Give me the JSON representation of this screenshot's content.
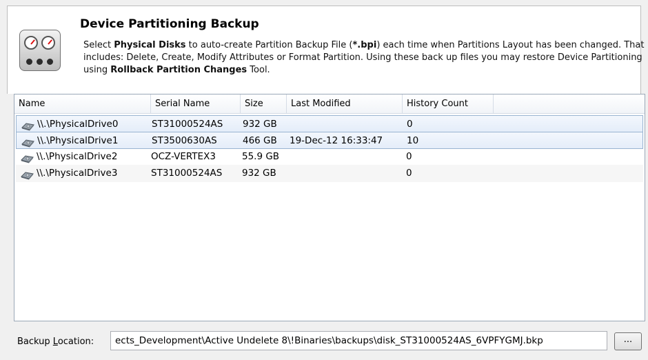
{
  "header": {
    "title": "Device Partitioning Backup",
    "desc": [
      {
        "t": "Select "
      },
      {
        "t": "Physical Disks",
        "b": true
      },
      {
        "t": " to auto-create  Partition Backup File ("
      },
      {
        "t": "*.bpi",
        "b": true
      },
      {
        "t": ") each time when Partitions Layout has been changed. That includes: Delete, Create, Modify Attributes or Format Partition. Using these back up files you may restore Device Partitioning using "
      },
      {
        "t": "Rollback Partition Changes",
        "b": true
      },
      {
        "t": " Tool."
      }
    ]
  },
  "columns": [
    "Name",
    "Serial Name",
    "Size",
    "Last Modified",
    "History Count"
  ],
  "rows": [
    {
      "name": "\\\\.\\PhysicalDrive0",
      "serial": "ST31000524AS",
      "size": "932 GB",
      "modified": "",
      "history": "0",
      "state": "selected"
    },
    {
      "name": "\\\\.\\PhysicalDrive1",
      "serial": "ST3500630AS",
      "size": "466 GB",
      "modified": "19-Dec-12 16:33:47",
      "history": "10",
      "state": "selected"
    },
    {
      "name": "\\\\.\\PhysicalDrive2",
      "serial": "OCZ-VERTEX3",
      "size": "55.9 GB",
      "modified": "",
      "history": "0",
      "state": "normal"
    },
    {
      "name": "\\\\.\\PhysicalDrive3",
      "serial": "ST31000524AS",
      "size": "932 GB",
      "modified": "",
      "history": "0",
      "state": "alt"
    }
  ],
  "backup": {
    "label_pre": "Backup ",
    "label_ul": "L",
    "label_post": "ocation:",
    "value": "ects_Development\\Active Undelete 8\\!Binaries\\backups\\disk_ST31000524AS_6VPFYGMJ.bkp",
    "browse_label": "..."
  },
  "icons": {
    "header": "gauges-icon",
    "drive": "hard-drive-icon"
  }
}
